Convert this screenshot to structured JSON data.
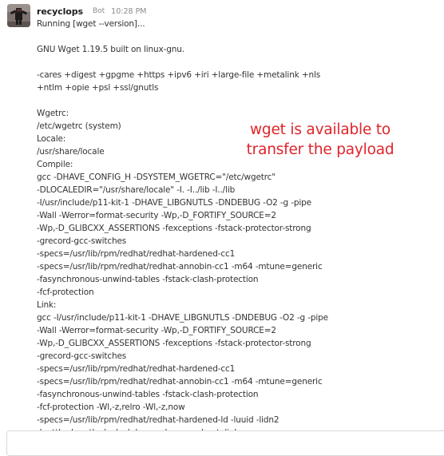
{
  "message": {
    "sender": "recyclops",
    "bot_badge": "Bot",
    "timestamp": "10:28 PM",
    "lines": [
      "Running [wget --version]...",
      "",
      "GNU Wget 1.19.5 built on linux-gnu.",
      "",
      "-cares +digest +gpgme +https +ipv6 +iri +large-file +metalink +nls",
      "+ntlm +opie +psl +ssl/gnutls",
      "",
      "Wgetrc:",
      "/etc/wgetrc (system)",
      "Locale:",
      "/usr/share/locale",
      "Compile:",
      "gcc -DHAVE_CONFIG_H -DSYSTEM_WGETRC=\"/etc/wgetrc\"",
      "-DLOCALEDIR=\"/usr/share/locale\" -I. -I../lib -I../lib",
      "-I/usr/include/p11-kit-1 -DHAVE_LIBGNUTLS -DNDEBUG -O2 -g -pipe",
      "-Wall -Werror=format-security -Wp,-D_FORTIFY_SOURCE=2",
      "-Wp,-D_GLIBCXX_ASSERTIONS -fexceptions -fstack-protector-strong",
      "-grecord-gcc-switches",
      "-specs=/usr/lib/rpm/redhat/redhat-hardened-cc1",
      "-specs=/usr/lib/rpm/redhat/redhat-annobin-cc1 -m64 -mtune=generic",
      "-fasynchronous-unwind-tables -fstack-clash-protection",
      "-fcf-protection",
      "Link:",
      "gcc -I/usr/include/p11-kit-1 -DHAVE_LIBGNUTLS -DNDEBUG -O2 -g -pipe",
      "-Wall -Werror=format-security -Wp,-D_FORTIFY_SOURCE=2",
      "-Wp,-D_GLIBCXX_ASSERTIONS -fexceptions -fstack-protector-strong",
      "-grecord-gcc-switches",
      "-specs=/usr/lib/rpm/redhat/redhat-hardened-cc1",
      "-specs=/usr/lib/rpm/redhat/redhat-annobin-cc1 -m64 -mtune=generic",
      "-fasynchronous-unwind-tables -fstack-clash-protection",
      "-fcf-protection -Wl,-z,relro -Wl,-z,now",
      "-specs=/usr/lib/rpm/redhat/redhat-hardened-ld -luuid -lidn2",
      "-lnettle -lgnutls -lz -lpsl -lcares -lgpgme -lmetalink"
    ]
  },
  "annotation": {
    "line1": "wget is available to",
    "line2": "transfer the payload",
    "color": "#e0242a"
  },
  "colors": {
    "text": "#333333",
    "muted": "#8b8b8b",
    "border": "#d7d7d7"
  }
}
